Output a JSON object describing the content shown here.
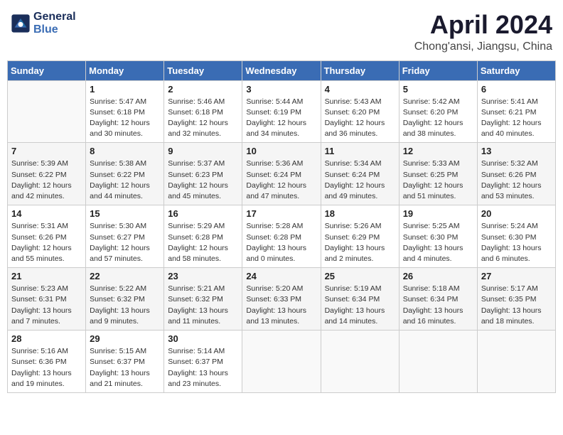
{
  "header": {
    "logo_line1": "General",
    "logo_line2": "Blue",
    "title": "April 2024",
    "subtitle": "Chong'ansi, Jiangsu, China"
  },
  "columns": [
    "Sunday",
    "Monday",
    "Tuesday",
    "Wednesday",
    "Thursday",
    "Friday",
    "Saturday"
  ],
  "weeks": [
    [
      {
        "day": "",
        "info": ""
      },
      {
        "day": "1",
        "info": "Sunrise: 5:47 AM\nSunset: 6:18 PM\nDaylight: 12 hours\nand 30 minutes."
      },
      {
        "day": "2",
        "info": "Sunrise: 5:46 AM\nSunset: 6:18 PM\nDaylight: 12 hours\nand 32 minutes."
      },
      {
        "day": "3",
        "info": "Sunrise: 5:44 AM\nSunset: 6:19 PM\nDaylight: 12 hours\nand 34 minutes."
      },
      {
        "day": "4",
        "info": "Sunrise: 5:43 AM\nSunset: 6:20 PM\nDaylight: 12 hours\nand 36 minutes."
      },
      {
        "day": "5",
        "info": "Sunrise: 5:42 AM\nSunset: 6:20 PM\nDaylight: 12 hours\nand 38 minutes."
      },
      {
        "day": "6",
        "info": "Sunrise: 5:41 AM\nSunset: 6:21 PM\nDaylight: 12 hours\nand 40 minutes."
      }
    ],
    [
      {
        "day": "7",
        "info": "Sunrise: 5:39 AM\nSunset: 6:22 PM\nDaylight: 12 hours\nand 42 minutes."
      },
      {
        "day": "8",
        "info": "Sunrise: 5:38 AM\nSunset: 6:22 PM\nDaylight: 12 hours\nand 44 minutes."
      },
      {
        "day": "9",
        "info": "Sunrise: 5:37 AM\nSunset: 6:23 PM\nDaylight: 12 hours\nand 45 minutes."
      },
      {
        "day": "10",
        "info": "Sunrise: 5:36 AM\nSunset: 6:24 PM\nDaylight: 12 hours\nand 47 minutes."
      },
      {
        "day": "11",
        "info": "Sunrise: 5:34 AM\nSunset: 6:24 PM\nDaylight: 12 hours\nand 49 minutes."
      },
      {
        "day": "12",
        "info": "Sunrise: 5:33 AM\nSunset: 6:25 PM\nDaylight: 12 hours\nand 51 minutes."
      },
      {
        "day": "13",
        "info": "Sunrise: 5:32 AM\nSunset: 6:26 PM\nDaylight: 12 hours\nand 53 minutes."
      }
    ],
    [
      {
        "day": "14",
        "info": "Sunrise: 5:31 AM\nSunset: 6:26 PM\nDaylight: 12 hours\nand 55 minutes."
      },
      {
        "day": "15",
        "info": "Sunrise: 5:30 AM\nSunset: 6:27 PM\nDaylight: 12 hours\nand 57 minutes."
      },
      {
        "day": "16",
        "info": "Sunrise: 5:29 AM\nSunset: 6:28 PM\nDaylight: 12 hours\nand 58 minutes."
      },
      {
        "day": "17",
        "info": "Sunrise: 5:28 AM\nSunset: 6:28 PM\nDaylight: 13 hours\nand 0 minutes."
      },
      {
        "day": "18",
        "info": "Sunrise: 5:26 AM\nSunset: 6:29 PM\nDaylight: 13 hours\nand 2 minutes."
      },
      {
        "day": "19",
        "info": "Sunrise: 5:25 AM\nSunset: 6:30 PM\nDaylight: 13 hours\nand 4 minutes."
      },
      {
        "day": "20",
        "info": "Sunrise: 5:24 AM\nSunset: 6:30 PM\nDaylight: 13 hours\nand 6 minutes."
      }
    ],
    [
      {
        "day": "21",
        "info": "Sunrise: 5:23 AM\nSunset: 6:31 PM\nDaylight: 13 hours\nand 7 minutes."
      },
      {
        "day": "22",
        "info": "Sunrise: 5:22 AM\nSunset: 6:32 PM\nDaylight: 13 hours\nand 9 minutes."
      },
      {
        "day": "23",
        "info": "Sunrise: 5:21 AM\nSunset: 6:32 PM\nDaylight: 13 hours\nand 11 minutes."
      },
      {
        "day": "24",
        "info": "Sunrise: 5:20 AM\nSunset: 6:33 PM\nDaylight: 13 hours\nand 13 minutes."
      },
      {
        "day": "25",
        "info": "Sunrise: 5:19 AM\nSunset: 6:34 PM\nDaylight: 13 hours\nand 14 minutes."
      },
      {
        "day": "26",
        "info": "Sunrise: 5:18 AM\nSunset: 6:34 PM\nDaylight: 13 hours\nand 16 minutes."
      },
      {
        "day": "27",
        "info": "Sunrise: 5:17 AM\nSunset: 6:35 PM\nDaylight: 13 hours\nand 18 minutes."
      }
    ],
    [
      {
        "day": "28",
        "info": "Sunrise: 5:16 AM\nSunset: 6:36 PM\nDaylight: 13 hours\nand 19 minutes."
      },
      {
        "day": "29",
        "info": "Sunrise: 5:15 AM\nSunset: 6:37 PM\nDaylight: 13 hours\nand 21 minutes."
      },
      {
        "day": "30",
        "info": "Sunrise: 5:14 AM\nSunset: 6:37 PM\nDaylight: 13 hours\nand 23 minutes."
      },
      {
        "day": "",
        "info": ""
      },
      {
        "day": "",
        "info": ""
      },
      {
        "day": "",
        "info": ""
      },
      {
        "day": "",
        "info": ""
      }
    ]
  ]
}
